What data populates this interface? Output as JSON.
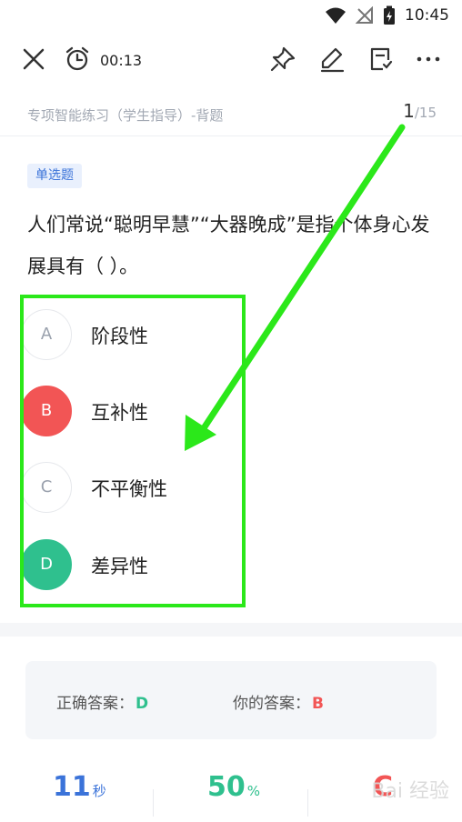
{
  "status_bar": {
    "time": "10:45",
    "icons": [
      "wifi-icon",
      "no-signal-icon",
      "battery-charging-icon"
    ]
  },
  "toolbar": {
    "timer": "00:13",
    "icons": [
      "close-icon",
      "alarm-clock-icon",
      "pin-icon",
      "edit-icon",
      "note-icon",
      "more-icon"
    ]
  },
  "header": {
    "title": "专项智能练习（学生指导）-背题",
    "current": "1",
    "total": "/15"
  },
  "question": {
    "type_label": "单选题",
    "text": "人们常说“聪明早慧”“大器晚成”是指个体身心发展具有（ ）。",
    "options": [
      {
        "letter": "A",
        "text": "阶段性",
        "state": "normal"
      },
      {
        "letter": "B",
        "text": "互补性",
        "state": "wrong"
      },
      {
        "letter": "C",
        "text": "不平衡性",
        "state": "normal"
      },
      {
        "letter": "D",
        "text": "差异性",
        "state": "correct"
      }
    ]
  },
  "answer": {
    "correct_label": "正确答案：",
    "correct_value": "D",
    "yours_label": "你的答案：",
    "yours_value": "B"
  },
  "stats": [
    {
      "num": "11",
      "unit": "秒",
      "color": "#3b73d9"
    },
    {
      "num": "50",
      "unit": "%",
      "color": "#2fc08e"
    },
    {
      "num": "C",
      "unit": "",
      "color": "#f25555"
    }
  ],
  "watermark": "Bai 经验",
  "colors": {
    "accent_blue": "#3b73d9",
    "correct_green": "#2fc08e",
    "wrong_red": "#f25555",
    "annotation_green": "#2be81a"
  }
}
